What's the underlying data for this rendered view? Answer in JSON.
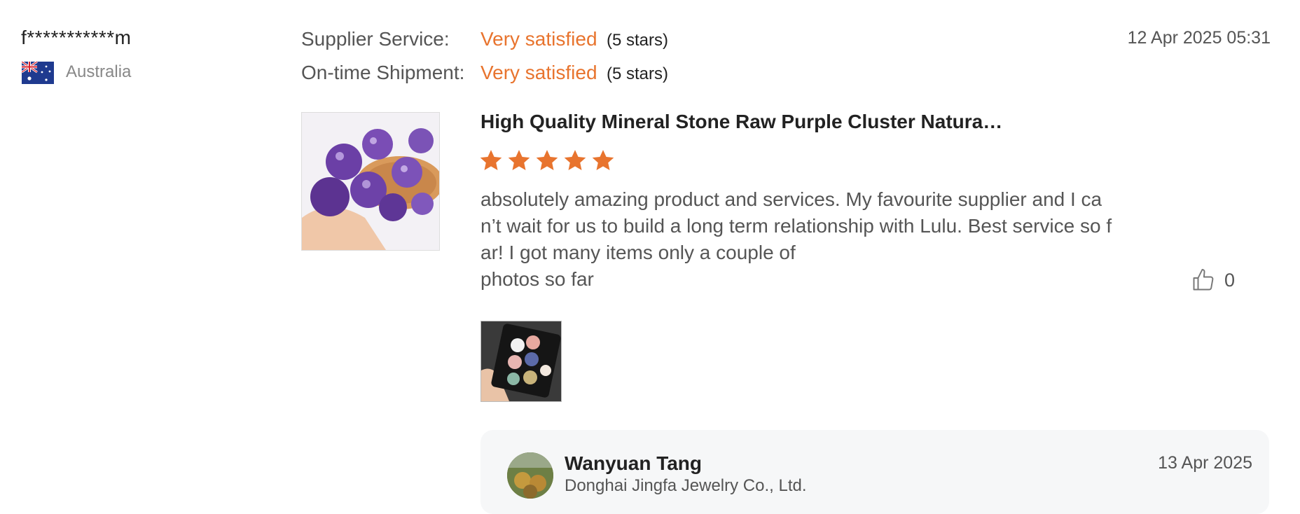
{
  "reviewer": {
    "name": "f***********m",
    "country": "Australia",
    "flag_icon": "australia-flag-icon"
  },
  "ratings": [
    {
      "label": "Supplier Service:",
      "value": "Very satisfied",
      "stars_text": "(5 stars)"
    },
    {
      "label": "On-time Shipment:",
      "value": "Very satisfied",
      "stars_text": "(5 stars)"
    }
  ],
  "review": {
    "date": "12 Apr 2025 05:31",
    "product_title": "High Quality Mineral Stone Raw Purple Cluster Natura…",
    "star_count": 5,
    "star_color": "#e8742e",
    "text_lines": [
      "absolutely amazing product and services. My favourite supplier and I ca",
      "n’t wait for us to build a long term relationship with Lulu. Best service so f",
      "ar! I got many items only a couple of",
      "photos so far"
    ],
    "likes": "0",
    "like_icon": "thumbs-up-icon"
  },
  "reply": {
    "name": "Wanyuan Tang",
    "company": "Donghai Jingfa Jewelry Co., Ltd.",
    "date": "13 Apr 2025"
  },
  "colors": {
    "accent": "#e8742e",
    "text_muted": "#555555",
    "reply_bg": "#f6f7f8"
  }
}
